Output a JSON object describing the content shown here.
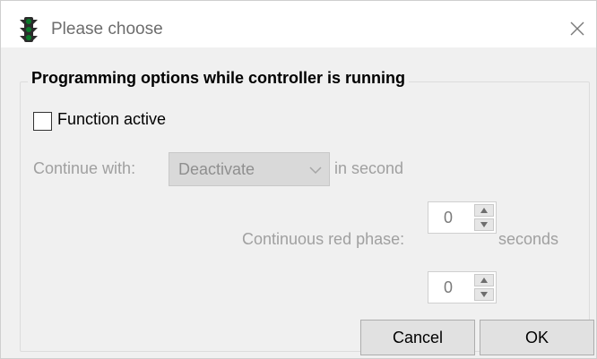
{
  "window": {
    "title": "Please choose",
    "close_glyph": "✕"
  },
  "icons": {
    "app": "traffic-light-icon",
    "close": "close-icon",
    "dropdown": "chevron-down-icon",
    "spin_up": "spin-up-icon",
    "spin_down": "spin-down-icon"
  },
  "group": {
    "title": "Programming options while controller is running"
  },
  "function_active": {
    "label": "Function active",
    "checked": false
  },
  "continue_with": {
    "label": "Continue with:",
    "selected": "Deactivate",
    "in_second_label": "in second",
    "in_second_value": "0"
  },
  "red_phase": {
    "label": "Continuous red phase:",
    "value": "0",
    "unit": "seconds"
  },
  "buttons": {
    "cancel": "Cancel",
    "ok": "OK"
  },
  "colors": {
    "dialog_bg": "#f0f0f0",
    "disabled_text": "#a0a0a0",
    "traffic_light": "#2b2b2b"
  }
}
